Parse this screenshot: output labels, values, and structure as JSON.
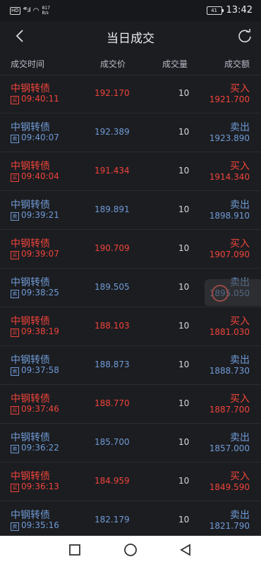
{
  "status_bar": {
    "network_badge": "HD",
    "signal_text": "⁴⁶.ıl",
    "speed_value": "817",
    "speed_unit": "B/s",
    "battery_text": "41",
    "time": "13:42"
  },
  "nav": {
    "title": "当日成交",
    "back_icon": "chevron-left-icon",
    "refresh_icon": "refresh-icon"
  },
  "table": {
    "headers": {
      "time": "成交时间",
      "price": "成交价",
      "volume": "成交量",
      "amount": "成交额"
    },
    "rows": [
      {
        "name": "中钢转债",
        "tag": "买",
        "time": "09:40:11",
        "price": "192.170",
        "volume": "10",
        "side": "买入",
        "amount": "1921.700",
        "type": "buy"
      },
      {
        "name": "中钢转债",
        "tag": "卖",
        "time": "09:40:07",
        "price": "192.389",
        "volume": "10",
        "side": "卖出",
        "amount": "1923.890",
        "type": "sell"
      },
      {
        "name": "中钢转债",
        "tag": "买",
        "time": "09:40:04",
        "price": "191.434",
        "volume": "10",
        "side": "买入",
        "amount": "1914.340",
        "type": "buy"
      },
      {
        "name": "中钢转债",
        "tag": "卖",
        "time": "09:39:21",
        "price": "189.891",
        "volume": "10",
        "side": "卖出",
        "amount": "1898.910",
        "type": "sell"
      },
      {
        "name": "中钢转债",
        "tag": "买",
        "time": "09:39:07",
        "price": "190.709",
        "volume": "10",
        "side": "买入",
        "amount": "1907.090",
        "type": "buy"
      },
      {
        "name": "中钢转债",
        "tag": "卖",
        "time": "09:38:25",
        "price": "189.505",
        "volume": "10",
        "side": "卖出",
        "amount": "1895.050",
        "type": "sell"
      },
      {
        "name": "中钢转债",
        "tag": "买",
        "time": "09:38:19",
        "price": "188.103",
        "volume": "10",
        "side": "买入",
        "amount": "1881.030",
        "type": "buy"
      },
      {
        "name": "中钢转债",
        "tag": "卖",
        "time": "09:37:58",
        "price": "188.873",
        "volume": "10",
        "side": "卖出",
        "amount": "1888.730",
        "type": "sell"
      },
      {
        "name": "中钢转债",
        "tag": "买",
        "time": "09:37:46",
        "price": "188.770",
        "volume": "10",
        "side": "买入",
        "amount": "1887.700",
        "type": "buy"
      },
      {
        "name": "中钢转债",
        "tag": "卖",
        "time": "09:36:22",
        "price": "185.700",
        "volume": "10",
        "side": "卖出",
        "amount": "1857.000",
        "type": "sell"
      },
      {
        "name": "中钢转债",
        "tag": "买",
        "time": "09:36:13",
        "price": "184.959",
        "volume": "10",
        "side": "买入",
        "amount": "1849.590",
        "type": "buy"
      },
      {
        "name": "中钢转债",
        "tag": "卖",
        "time": "09:35:16",
        "price": "182.179",
        "volume": "10",
        "side": "卖出",
        "amount": "1821.790",
        "type": "sell"
      }
    ]
  },
  "colors": {
    "buy": "#f0443a",
    "sell": "#6f9bd6",
    "background": "#1c1d21"
  },
  "system_nav": {
    "recent_icon": "square-icon",
    "home_icon": "circle-icon",
    "back_icon": "triangle-back-icon"
  }
}
